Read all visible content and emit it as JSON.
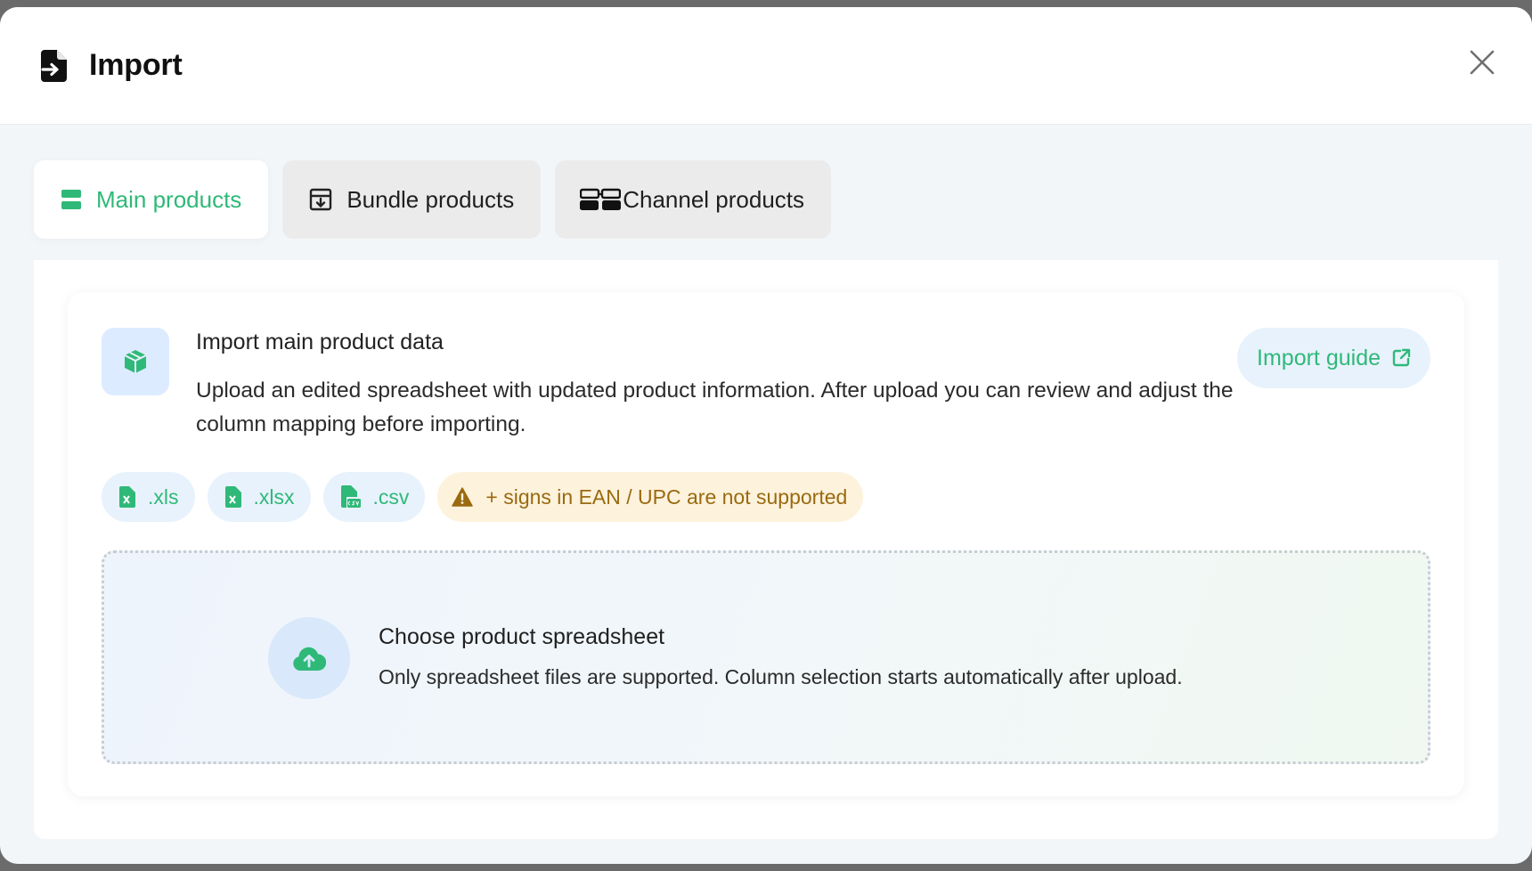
{
  "dialog": {
    "title": "Import",
    "title_icon": "file-import-icon",
    "close_icon": "close-icon"
  },
  "tabs": [
    {
      "label": "Main products",
      "icon": "table-rows-icon",
      "active": true
    },
    {
      "label": "Bundle products",
      "icon": "bundle-icon",
      "active": false
    },
    {
      "label": "Channel products",
      "icon": "channels-icon",
      "active": false
    }
  ],
  "card": {
    "icon": "box-icon",
    "title": "Import main product data",
    "description": "Upload an edited spreadsheet with updated product information. After upload you can review and adjust the column mapping before importing.",
    "guide_label": "Import guide",
    "guide_icon": "external-link-icon"
  },
  "formats": [
    {
      "label": ".xls",
      "icon": "excel-file-icon"
    },
    {
      "label": ".xlsx",
      "icon": "excel-file-icon"
    },
    {
      "label": ".csv",
      "icon": "csv-file-icon"
    }
  ],
  "warning": {
    "label": "+ signs in EAN / UPC are not supported",
    "icon": "warning-icon"
  },
  "dropzone": {
    "icon": "cloud-upload-icon",
    "title": "Choose product spreadsheet",
    "description": "Only spreadsheet files are supported. Column selection starts automatically after upload."
  },
  "colors": {
    "accent": "#2fb978",
    "chip_bg": "#e8f2fc",
    "warning_bg": "#fdf2dc",
    "warning_text": "#9a6a10"
  }
}
